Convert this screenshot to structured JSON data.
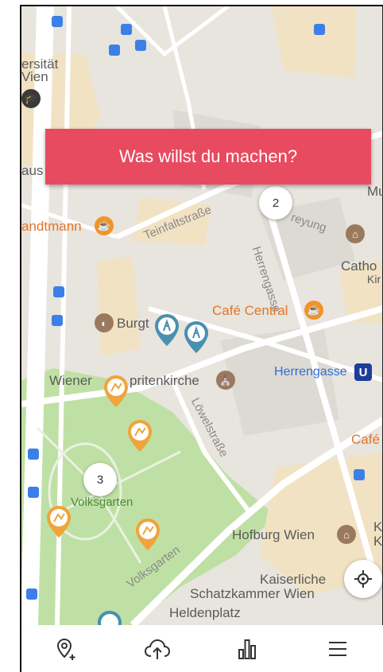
{
  "banner": {
    "question": "Was willst du machen?"
  },
  "map_labels": {
    "universitaet_line1": "ersität",
    "universitaet_line2": "Vien",
    "aus": "aus",
    "landtmann": "andtmann",
    "teinfaltstrasse": "Teinfaltstraße",
    "herrengasse_street": "Herrengasse",
    "freyung": "reyung",
    "mus": "Mus",
    "catho": "Catho",
    "kir": "Kir",
    "burgtheater": "Burgt",
    "cafe_central": "Café Central",
    "herrengasse_station": "Herrengasse",
    "metro_badge": "U",
    "minoritenkirche_left": "Wiener",
    "minoritenkirche_right": "pritenkirche",
    "loewelstrasse": "Löwelstraße",
    "cafe": "Café",
    "volksgarten_park": "Volksgarten",
    "volksgarten_road": "Volksgarten",
    "hofburg": "Hofburg Wien",
    "k1": "K",
    "k2": "K",
    "kaiserliche": "Kaiserliche",
    "schatzkammer": "Schatzkammer Wien",
    "heldenplatz": "Heldenplatz"
  },
  "clusters": [
    {
      "count": "2"
    },
    {
      "count": "3"
    }
  ],
  "icons": {
    "locate": "crosshair-icon",
    "nav": [
      "add-location-icon",
      "cloud-upload-icon",
      "bar-chart-icon",
      "menu-icon"
    ]
  },
  "colors": {
    "banner": "#e84a5f",
    "map_bg": "#e8e4de",
    "park": "#bfe0a5",
    "pin_blue": "#4a8fb0",
    "pin_orange": "#f0a43a",
    "metro": "#1e3d99"
  }
}
